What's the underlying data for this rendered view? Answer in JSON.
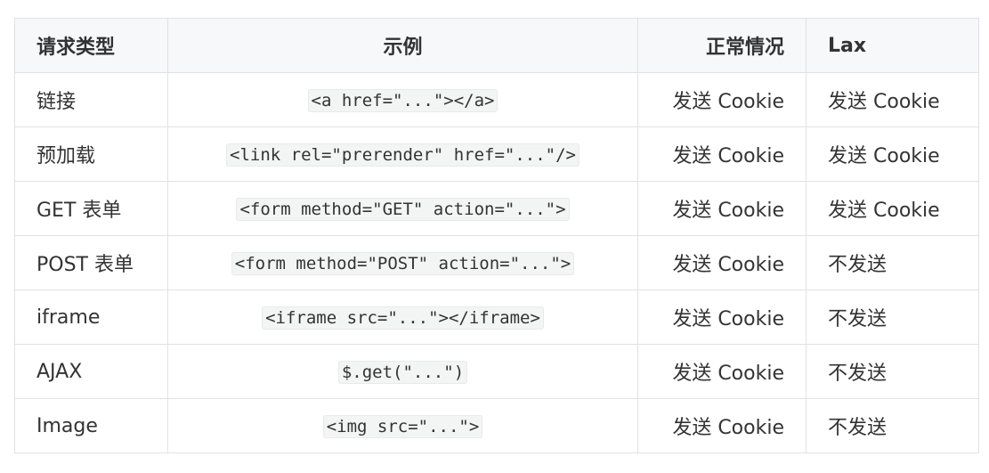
{
  "table": {
    "headers": [
      "请求类型",
      "示例",
      "正常情况",
      "Lax"
    ],
    "rows": [
      {
        "type": "链接",
        "example": "<a href=\"...\"></a>",
        "normal": "发送 Cookie",
        "lax": "发送 Cookie"
      },
      {
        "type": "预加载",
        "example": "<link rel=\"prerender\" href=\"...\"/>",
        "normal": "发送 Cookie",
        "lax": "发送 Cookie"
      },
      {
        "type": "GET 表单",
        "example": "<form method=\"GET\" action=\"...\">",
        "normal": "发送 Cookie",
        "lax": "发送 Cookie"
      },
      {
        "type": "POST 表单",
        "example": "<form method=\"POST\" action=\"...\">",
        "normal": "发送 Cookie",
        "lax": "不发送"
      },
      {
        "type": "iframe",
        "example": "<iframe src=\"...\"></iframe>",
        "normal": "发送 Cookie",
        "lax": "不发送"
      },
      {
        "type": "AJAX",
        "example": "$.get(\"...\")",
        "normal": "发送 Cookie",
        "lax": "不发送"
      },
      {
        "type": "Image",
        "example": "<img src=\"...\">",
        "normal": "发送 Cookie",
        "lax": "不发送"
      }
    ]
  }
}
